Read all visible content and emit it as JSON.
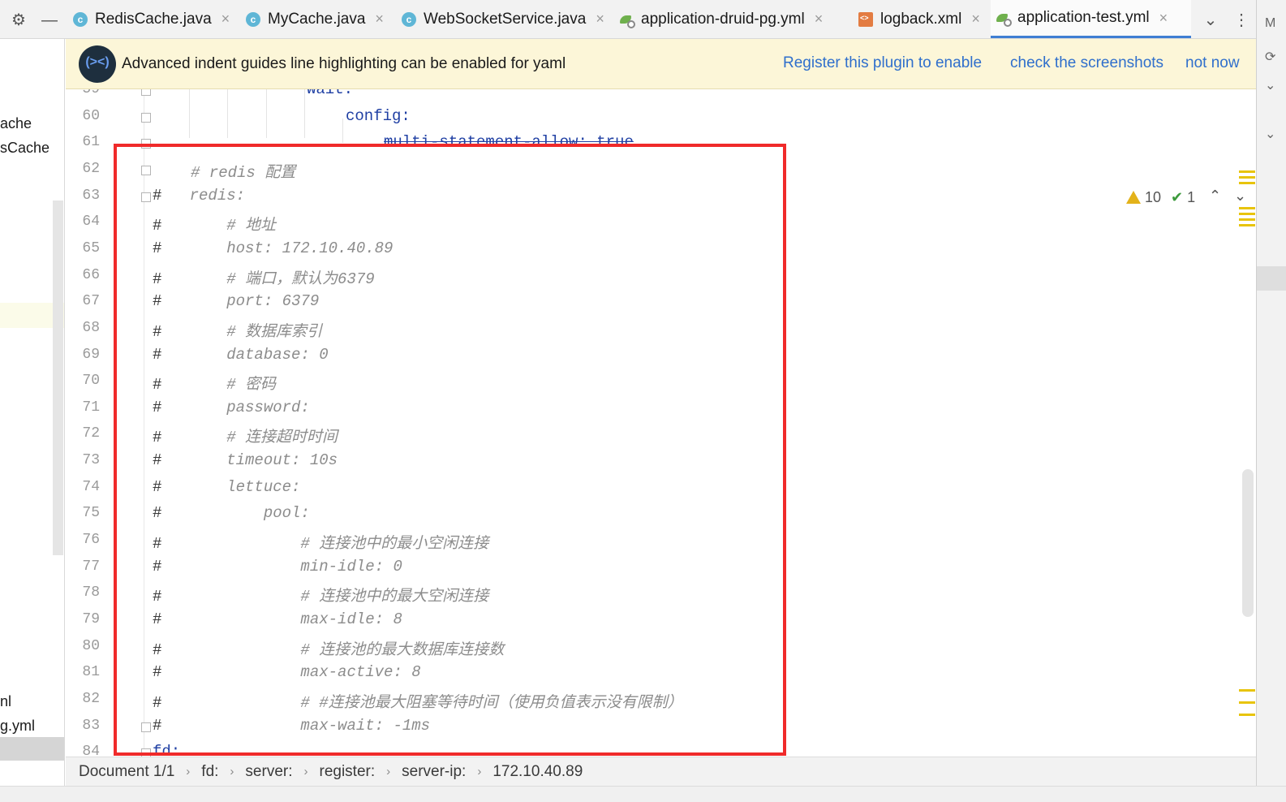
{
  "tabs": [
    {
      "label": "RedisCache.java",
      "type": "java",
      "active": false
    },
    {
      "label": "MyCache.java",
      "type": "java",
      "active": false
    },
    {
      "label": "WebSocketService.java",
      "type": "java",
      "active": false
    },
    {
      "label": "application-druid-pg.yml",
      "type": "yml",
      "active": false
    },
    {
      "label": "logback.xml",
      "type": "xml",
      "active": false
    },
    {
      "label": "application-test.yml",
      "type": "yml",
      "active": true
    }
  ],
  "tab_close_glyph": "×",
  "toolbar": {
    "settings_icon": "gear-icon",
    "minimize_icon": "minus-icon",
    "more_tabs_glyph": "⌄",
    "menu_glyph": "⋮"
  },
  "project_panel": {
    "items": [
      "ache",
      "sCache",
      "nl",
      "g.yml"
    ]
  },
  "banner": {
    "message": "Advanced indent guides line highlighting can be enabled for yaml",
    "register_link": "Register this plugin to enable",
    "screenshots_link": "check the screenshots",
    "dismiss_link": "not now",
    "logo_text": "(><)"
  },
  "inspections": {
    "warnings": "10",
    "ok": "1",
    "prev_glyph": "⌃",
    "next_glyph": "⌄"
  },
  "editor": {
    "lines": [
      {
        "n": "59",
        "parts": [
          {
            "t": "wait:",
            "c": "k"
          }
        ]
      },
      {
        "n": "60",
        "parts": [
          {
            "t": "config:",
            "c": "k"
          }
        ]
      },
      {
        "n": "61",
        "parts": [
          {
            "t": "multi-statement-allow: true",
            "c": "k strike"
          }
        ]
      },
      {
        "n": "62",
        "parts": [
          {
            "t": "# redis 配置",
            "c": "cm"
          }
        ]
      },
      {
        "n": "63",
        "parts": [
          {
            "t": "#",
            "c": "hashg"
          },
          {
            "t": "   redis:",
            "c": "cm"
          }
        ]
      },
      {
        "n": "64",
        "parts": [
          {
            "t": "#",
            "c": "hashg"
          },
          {
            "t": "       # 地址",
            "c": "cm"
          }
        ]
      },
      {
        "n": "65",
        "parts": [
          {
            "t": "#",
            "c": "hashg"
          },
          {
            "t": "       host: 172.10.40.89",
            "c": "cm"
          }
        ]
      },
      {
        "n": "66",
        "parts": [
          {
            "t": "#",
            "c": "hashg"
          },
          {
            "t": "       # 端口，默认为6379",
            "c": "cm"
          }
        ]
      },
      {
        "n": "67",
        "parts": [
          {
            "t": "#",
            "c": "hashg"
          },
          {
            "t": "       port: 6379",
            "c": "cm"
          }
        ]
      },
      {
        "n": "68",
        "parts": [
          {
            "t": "#",
            "c": "hashg"
          },
          {
            "t": "       # 数据库索引",
            "c": "cm"
          }
        ]
      },
      {
        "n": "69",
        "parts": [
          {
            "t": "#",
            "c": "hashg"
          },
          {
            "t": "       database: 0",
            "c": "cm"
          }
        ]
      },
      {
        "n": "70",
        "parts": [
          {
            "t": "#",
            "c": "hashg"
          },
          {
            "t": "       # 密码",
            "c": "cm"
          }
        ]
      },
      {
        "n": "71",
        "parts": [
          {
            "t": "#",
            "c": "hashg"
          },
          {
            "t": "       password:",
            "c": "cm"
          }
        ]
      },
      {
        "n": "72",
        "parts": [
          {
            "t": "#",
            "c": "hashg"
          },
          {
            "t": "       # 连接超时时间",
            "c": "cm"
          }
        ]
      },
      {
        "n": "73",
        "parts": [
          {
            "t": "#",
            "c": "hashg"
          },
          {
            "t": "       timeout: 10s",
            "c": "cm"
          }
        ]
      },
      {
        "n": "74",
        "parts": [
          {
            "t": "#",
            "c": "hashg"
          },
          {
            "t": "       lettuce:",
            "c": "cm"
          }
        ]
      },
      {
        "n": "75",
        "parts": [
          {
            "t": "#",
            "c": "hashg"
          },
          {
            "t": "           pool:",
            "c": "cm"
          }
        ]
      },
      {
        "n": "76",
        "parts": [
          {
            "t": "#",
            "c": "hashg"
          },
          {
            "t": "               # 连接池中的最小空闲连接",
            "c": "cm"
          }
        ]
      },
      {
        "n": "77",
        "parts": [
          {
            "t": "#",
            "c": "hashg"
          },
          {
            "t": "               min-idle: 0",
            "c": "cm"
          }
        ]
      },
      {
        "n": "78",
        "parts": [
          {
            "t": "#",
            "c": "hashg"
          },
          {
            "t": "               # 连接池中的最大空闲连接",
            "c": "cm"
          }
        ]
      },
      {
        "n": "79",
        "parts": [
          {
            "t": "#",
            "c": "hashg"
          },
          {
            "t": "               max-idle: 8",
            "c": "cm"
          }
        ]
      },
      {
        "n": "80",
        "parts": [
          {
            "t": "#",
            "c": "hashg"
          },
          {
            "t": "               # 连接池的最大数据库连接数",
            "c": "cm"
          }
        ]
      },
      {
        "n": "81",
        "parts": [
          {
            "t": "#",
            "c": "hashg"
          },
          {
            "t": "               max-active: 8",
            "c": "cm"
          }
        ]
      },
      {
        "n": "82",
        "parts": [
          {
            "t": "#",
            "c": "hashg"
          },
          {
            "t": "               # #连接池最大阻塞等待时间（使用负值表示没有限制）",
            "c": "cm"
          }
        ]
      },
      {
        "n": "83",
        "parts": [
          {
            "t": "#",
            "c": "hashg"
          },
          {
            "t": "               max-wait: -1ms",
            "c": "cm"
          }
        ]
      },
      {
        "n": "84",
        "parts": [
          {
            "t": "fd:",
            "c": "k"
          }
        ]
      }
    ]
  },
  "right_panel": {
    "items": [
      "M"
    ]
  },
  "breadcrumb": [
    "Document 1/1",
    "fd:",
    "server:",
    "register:",
    "server-ip:",
    "172.10.40.89"
  ],
  "breadcrumb_sep": "›",
  "colors": {
    "accent": "#3f7fd3",
    "highlight_box": "#f02a2a",
    "banner_bg": "#fcf6d8",
    "link": "#2f6fcc",
    "key": "#1f3fa3",
    "comment": "#8c8c8c"
  }
}
